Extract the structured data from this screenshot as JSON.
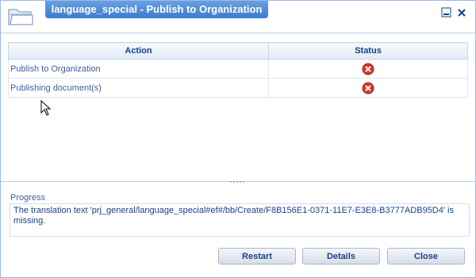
{
  "window": {
    "title": "language_special - Publish to Organization",
    "icon": "folder-icon"
  },
  "table": {
    "columns": [
      "Action",
      "Status"
    ],
    "rows": [
      {
        "action": "Publish to Organization",
        "status": "error-icon"
      },
      {
        "action": "Publishing document(s)",
        "status": "error-icon"
      }
    ]
  },
  "progress": {
    "label": "Progress",
    "text": "The translation text 'prj_general/language_special#ef#/bb/Create/F8B156E1-0371-11E7-E3E8-B3777ADB95D4' is missing."
  },
  "buttons": {
    "restart": "Restart",
    "details": "Details",
    "close": "Close"
  },
  "colors": {
    "accent": "#3c7ad0",
    "error": "#d9382b"
  }
}
